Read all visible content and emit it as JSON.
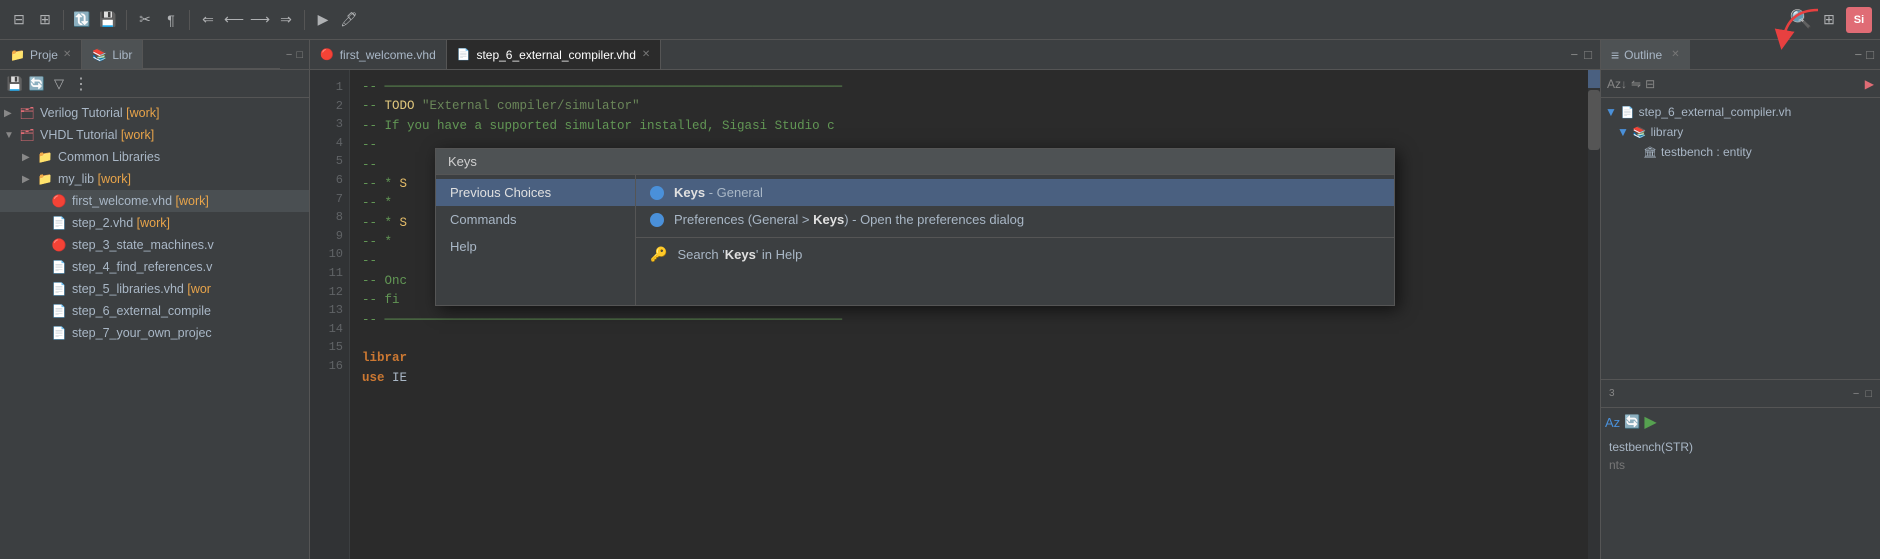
{
  "toolbar": {
    "icons": [
      "⊞",
      "⊡",
      "🔃",
      "💾",
      "📋",
      "🔄",
      "↩",
      "↪",
      "▶",
      "⏹",
      "✏",
      "🔦"
    ]
  },
  "sidebar": {
    "tabs": [
      {
        "label": "Proje",
        "icon": "📁",
        "active": false
      },
      {
        "label": "Libr",
        "icon": "📚",
        "active": false
      }
    ],
    "tree_items": [
      {
        "indent": 0,
        "arrow": "▶",
        "icon": "🗂",
        "label": "Verilog Tutorial",
        "badge": "[work]",
        "depth": 0
      },
      {
        "indent": 0,
        "arrow": "▼",
        "icon": "🗂",
        "label": "VHDL Tutorial",
        "badge": "[work]",
        "depth": 0
      },
      {
        "indent": 1,
        "arrow": "▶",
        "icon": "📁",
        "label": "Common Libraries",
        "badge": "",
        "depth": 1
      },
      {
        "indent": 1,
        "arrow": "▶",
        "icon": "📁",
        "label": "my_lib",
        "badge": "[work]",
        "depth": 1
      },
      {
        "indent": 1,
        "arrow": "",
        "icon": "🔴",
        "label": "first_welcome.vhd",
        "badge": "[work]",
        "depth": 1,
        "selected": true
      },
      {
        "indent": 1,
        "arrow": "",
        "icon": "📄",
        "label": "step_2.vhd",
        "badge": "[work]",
        "depth": 1
      },
      {
        "indent": 1,
        "arrow": "",
        "icon": "🔴",
        "label": "step_3_state_machines.v",
        "badge": "",
        "depth": 1
      },
      {
        "indent": 1,
        "arrow": "",
        "icon": "📄",
        "label": "step_4_find_references.v",
        "badge": "",
        "depth": 1
      },
      {
        "indent": 1,
        "arrow": "",
        "icon": "📄",
        "label": "step_5_libraries.vhd",
        "badge": "[wor",
        "depth": 1
      },
      {
        "indent": 1,
        "arrow": "",
        "icon": "📄",
        "label": "step_6_external_compile",
        "badge": "",
        "depth": 1
      },
      {
        "indent": 1,
        "arrow": "",
        "icon": "📄",
        "label": "step_7_your_own_projec",
        "badge": "",
        "depth": 1
      }
    ]
  },
  "editor": {
    "tabs": [
      {
        "label": "first_welcome.vhd",
        "icon": "🔴",
        "active": false,
        "closeable": false
      },
      {
        "label": "step_6_external_compiler.vhd",
        "icon": "📄",
        "active": true,
        "closeable": true
      }
    ],
    "lines": [
      {
        "num": 1,
        "content": "",
        "type": "dashes",
        "text": "-----------------------------------------------------------"
      },
      {
        "num": 2,
        "content": "",
        "type": "todo",
        "text": "-- TODO \"External compiler/simulator\""
      },
      {
        "num": 3,
        "content": "",
        "type": "comment",
        "text": "--   If you have a supported simulator installed, Sigasi Studio c"
      },
      {
        "num": 4,
        "content": "",
        "type": "comment",
        "text": "--"
      },
      {
        "num": 5,
        "content": "",
        "type": "comment",
        "text": "--"
      },
      {
        "num": 6,
        "content": "",
        "type": "starred",
        "text": "-- * S"
      },
      {
        "num": 7,
        "content": "",
        "type": "starred",
        "text": "-- * "
      },
      {
        "num": 8,
        "content": "",
        "type": "starred",
        "text": "-- * S"
      },
      {
        "num": 9,
        "content": "",
        "type": "starred",
        "text": "-- *"
      },
      {
        "num": 10,
        "content": "",
        "type": "comment",
        "text": "--"
      },
      {
        "num": 11,
        "content": "",
        "type": "comment",
        "text": "-- Onc"
      },
      {
        "num": 12,
        "content": "",
        "type": "comment",
        "text": "-- fi"
      },
      {
        "num": 13,
        "content": "",
        "type": "dashes",
        "text": "-----------------------------------------------------------"
      },
      {
        "num": 14,
        "content": "",
        "type": "blank",
        "text": ""
      },
      {
        "num": 15,
        "content": "",
        "type": "keyword",
        "text": "librar"
      },
      {
        "num": 16,
        "content": "",
        "type": "keyword",
        "text": "use IE"
      }
    ]
  },
  "outline": {
    "title": "Outline",
    "panel_label": "step_6_external_compiler.vh",
    "items": [
      {
        "indent": 0,
        "arrow": "▼",
        "icon": "📚",
        "label": "library"
      },
      {
        "indent": 1,
        "arrow": "",
        "icon": "🏛",
        "label": "testbench : entity"
      }
    ]
  },
  "popup": {
    "title": "Keys",
    "left_items": [
      {
        "label": "Previous Choices",
        "selected": true
      },
      {
        "label": "Commands",
        "selected": false
      },
      {
        "label": "Help",
        "selected": false
      }
    ],
    "right_items_previous": [
      {
        "dot": true,
        "text_start": "",
        "bold": "Keys",
        "text_end": " - General",
        "selected": true
      }
    ],
    "right_items_commands": [],
    "right_items_help": [
      {
        "icon": "🔑",
        "text_start": "Search '",
        "bold": "Keys",
        "text_end": "' in Help",
        "selected": false
      }
    ],
    "all_right_items": [
      {
        "dot": true,
        "icon": "",
        "text": "Keys - General",
        "bold_word": "Keys",
        "selected": true,
        "type": "dot"
      },
      {
        "dot": false,
        "icon": "",
        "text": "Preferences (General > Keys) - Open the preferences dialog",
        "bold_word": "Keys",
        "selected": false,
        "type": "dot"
      },
      {
        "dot": false,
        "icon": "🔑",
        "text": "Search 'Keys' in Help",
        "bold_word": "Keys",
        "selected": false,
        "type": "icon"
      }
    ]
  },
  "top_right": {
    "search_icon": "🔍",
    "layout_icon": "⊞",
    "user_icon": "Si"
  }
}
